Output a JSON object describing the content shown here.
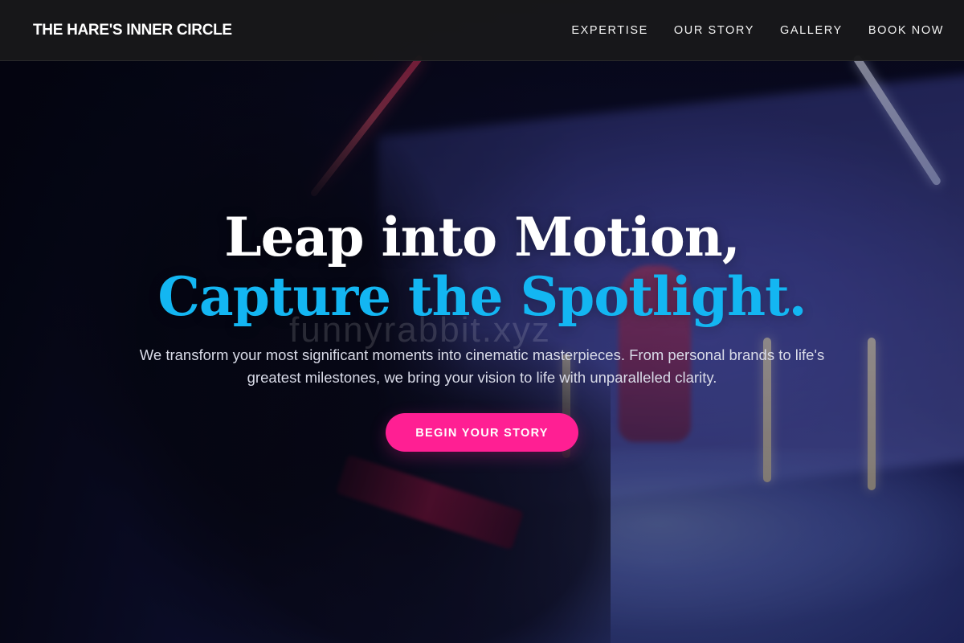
{
  "navbar": {
    "brand": "THE HARE'S INNER CIRCLE",
    "links": [
      {
        "label": "EXPERTISE"
      },
      {
        "label": "OUR STORY"
      },
      {
        "label": "GALLERY"
      },
      {
        "label": "BOOK NOW"
      }
    ]
  },
  "hero": {
    "headline_line1": "Leap into Motion,",
    "headline_line2": "Capture the Spotlight.",
    "subtext": "We transform your most significant moments into cinematic masterpieces. From personal brands to life's greatest milestones, we bring your vision to life with unparalleled clarity.",
    "cta_label": "BEGIN YOUR STORY",
    "watermark": "funnyrabbit.xyz"
  },
  "colors": {
    "navbar_bg": "#18181a",
    "accent_blue": "#13b6f2",
    "cta_pink": "#ff1f93",
    "text_white": "#ffffff"
  }
}
